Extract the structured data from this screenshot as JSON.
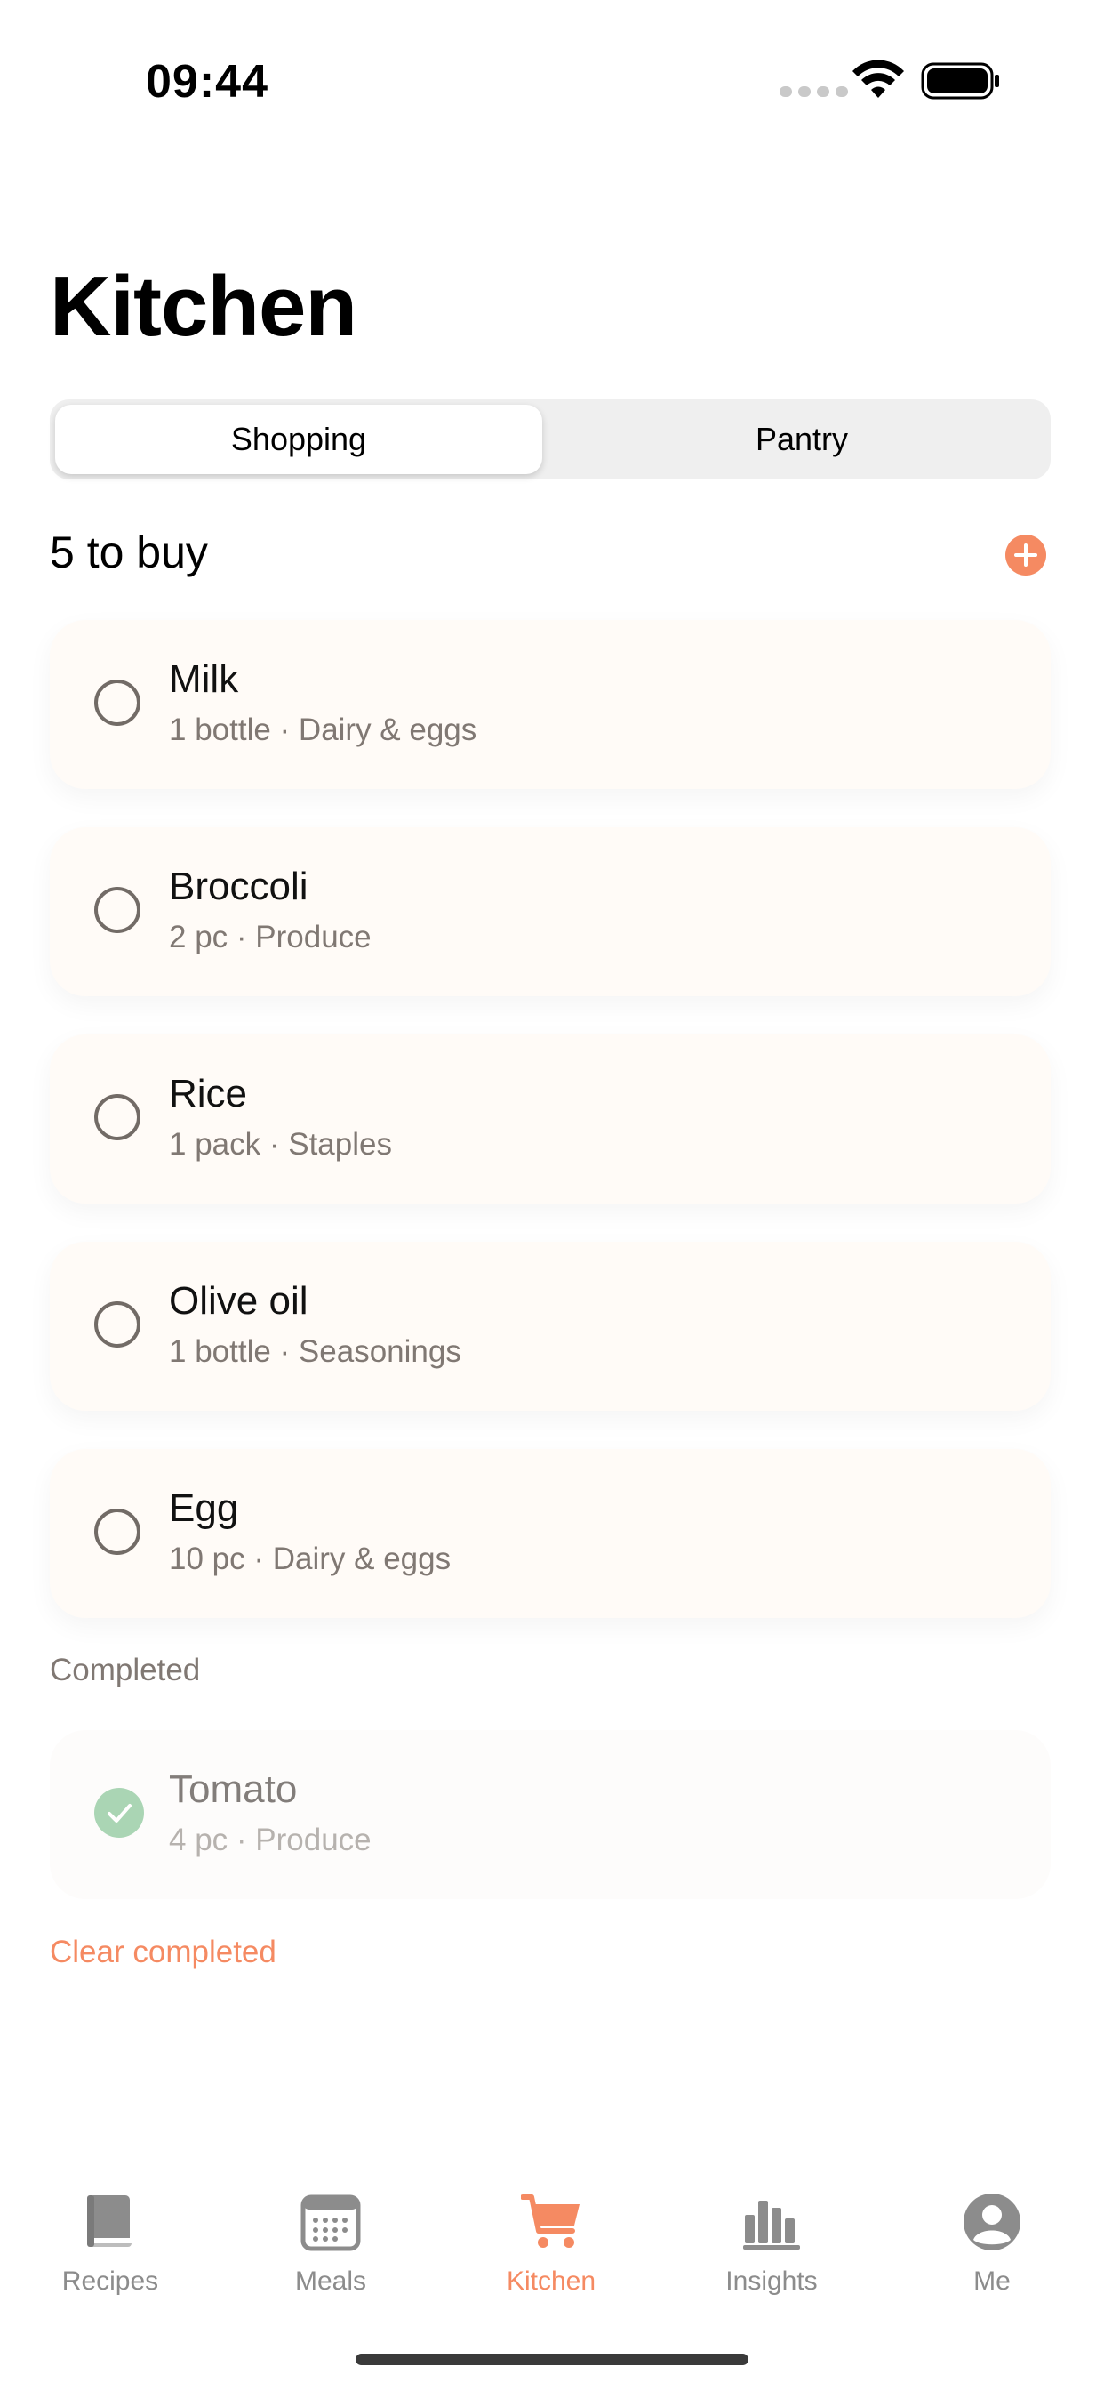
{
  "status_bar": {
    "time": "09:44"
  },
  "page_title": "Kitchen",
  "segments": {
    "shopping": "Shopping",
    "pantry": "Pantry"
  },
  "to_buy": {
    "header": "5 to buy",
    "items": [
      {
        "name": "Milk",
        "meta": "1 bottle · Dairy & eggs"
      },
      {
        "name": "Broccoli",
        "meta": "2 pc · Produce"
      },
      {
        "name": "Rice",
        "meta": "1 pack · Staples"
      },
      {
        "name": "Olive oil",
        "meta": "1 bottle · Seasonings"
      },
      {
        "name": "Egg",
        "meta": "10 pc · Dairy & eggs"
      }
    ]
  },
  "completed": {
    "label": "Completed",
    "items": [
      {
        "name": "Tomato",
        "meta": "4 pc · Produce"
      }
    ],
    "clear_label": "Clear completed"
  },
  "tab_bar": {
    "tabs": [
      {
        "label": "Recipes",
        "icon": "book-icon"
      },
      {
        "label": "Meals",
        "icon": "calendar-icon"
      },
      {
        "label": "Kitchen",
        "icon": "cart-icon"
      },
      {
        "label": "Insights",
        "icon": "bar-chart-icon"
      },
      {
        "label": "Me",
        "icon": "person-icon"
      }
    ],
    "active": "Kitchen"
  },
  "colors": {
    "accent": "#f58a62",
    "completed_check": "#a6d3b1",
    "card_background": "#fffbf7",
    "segment_background": "#efefef"
  }
}
